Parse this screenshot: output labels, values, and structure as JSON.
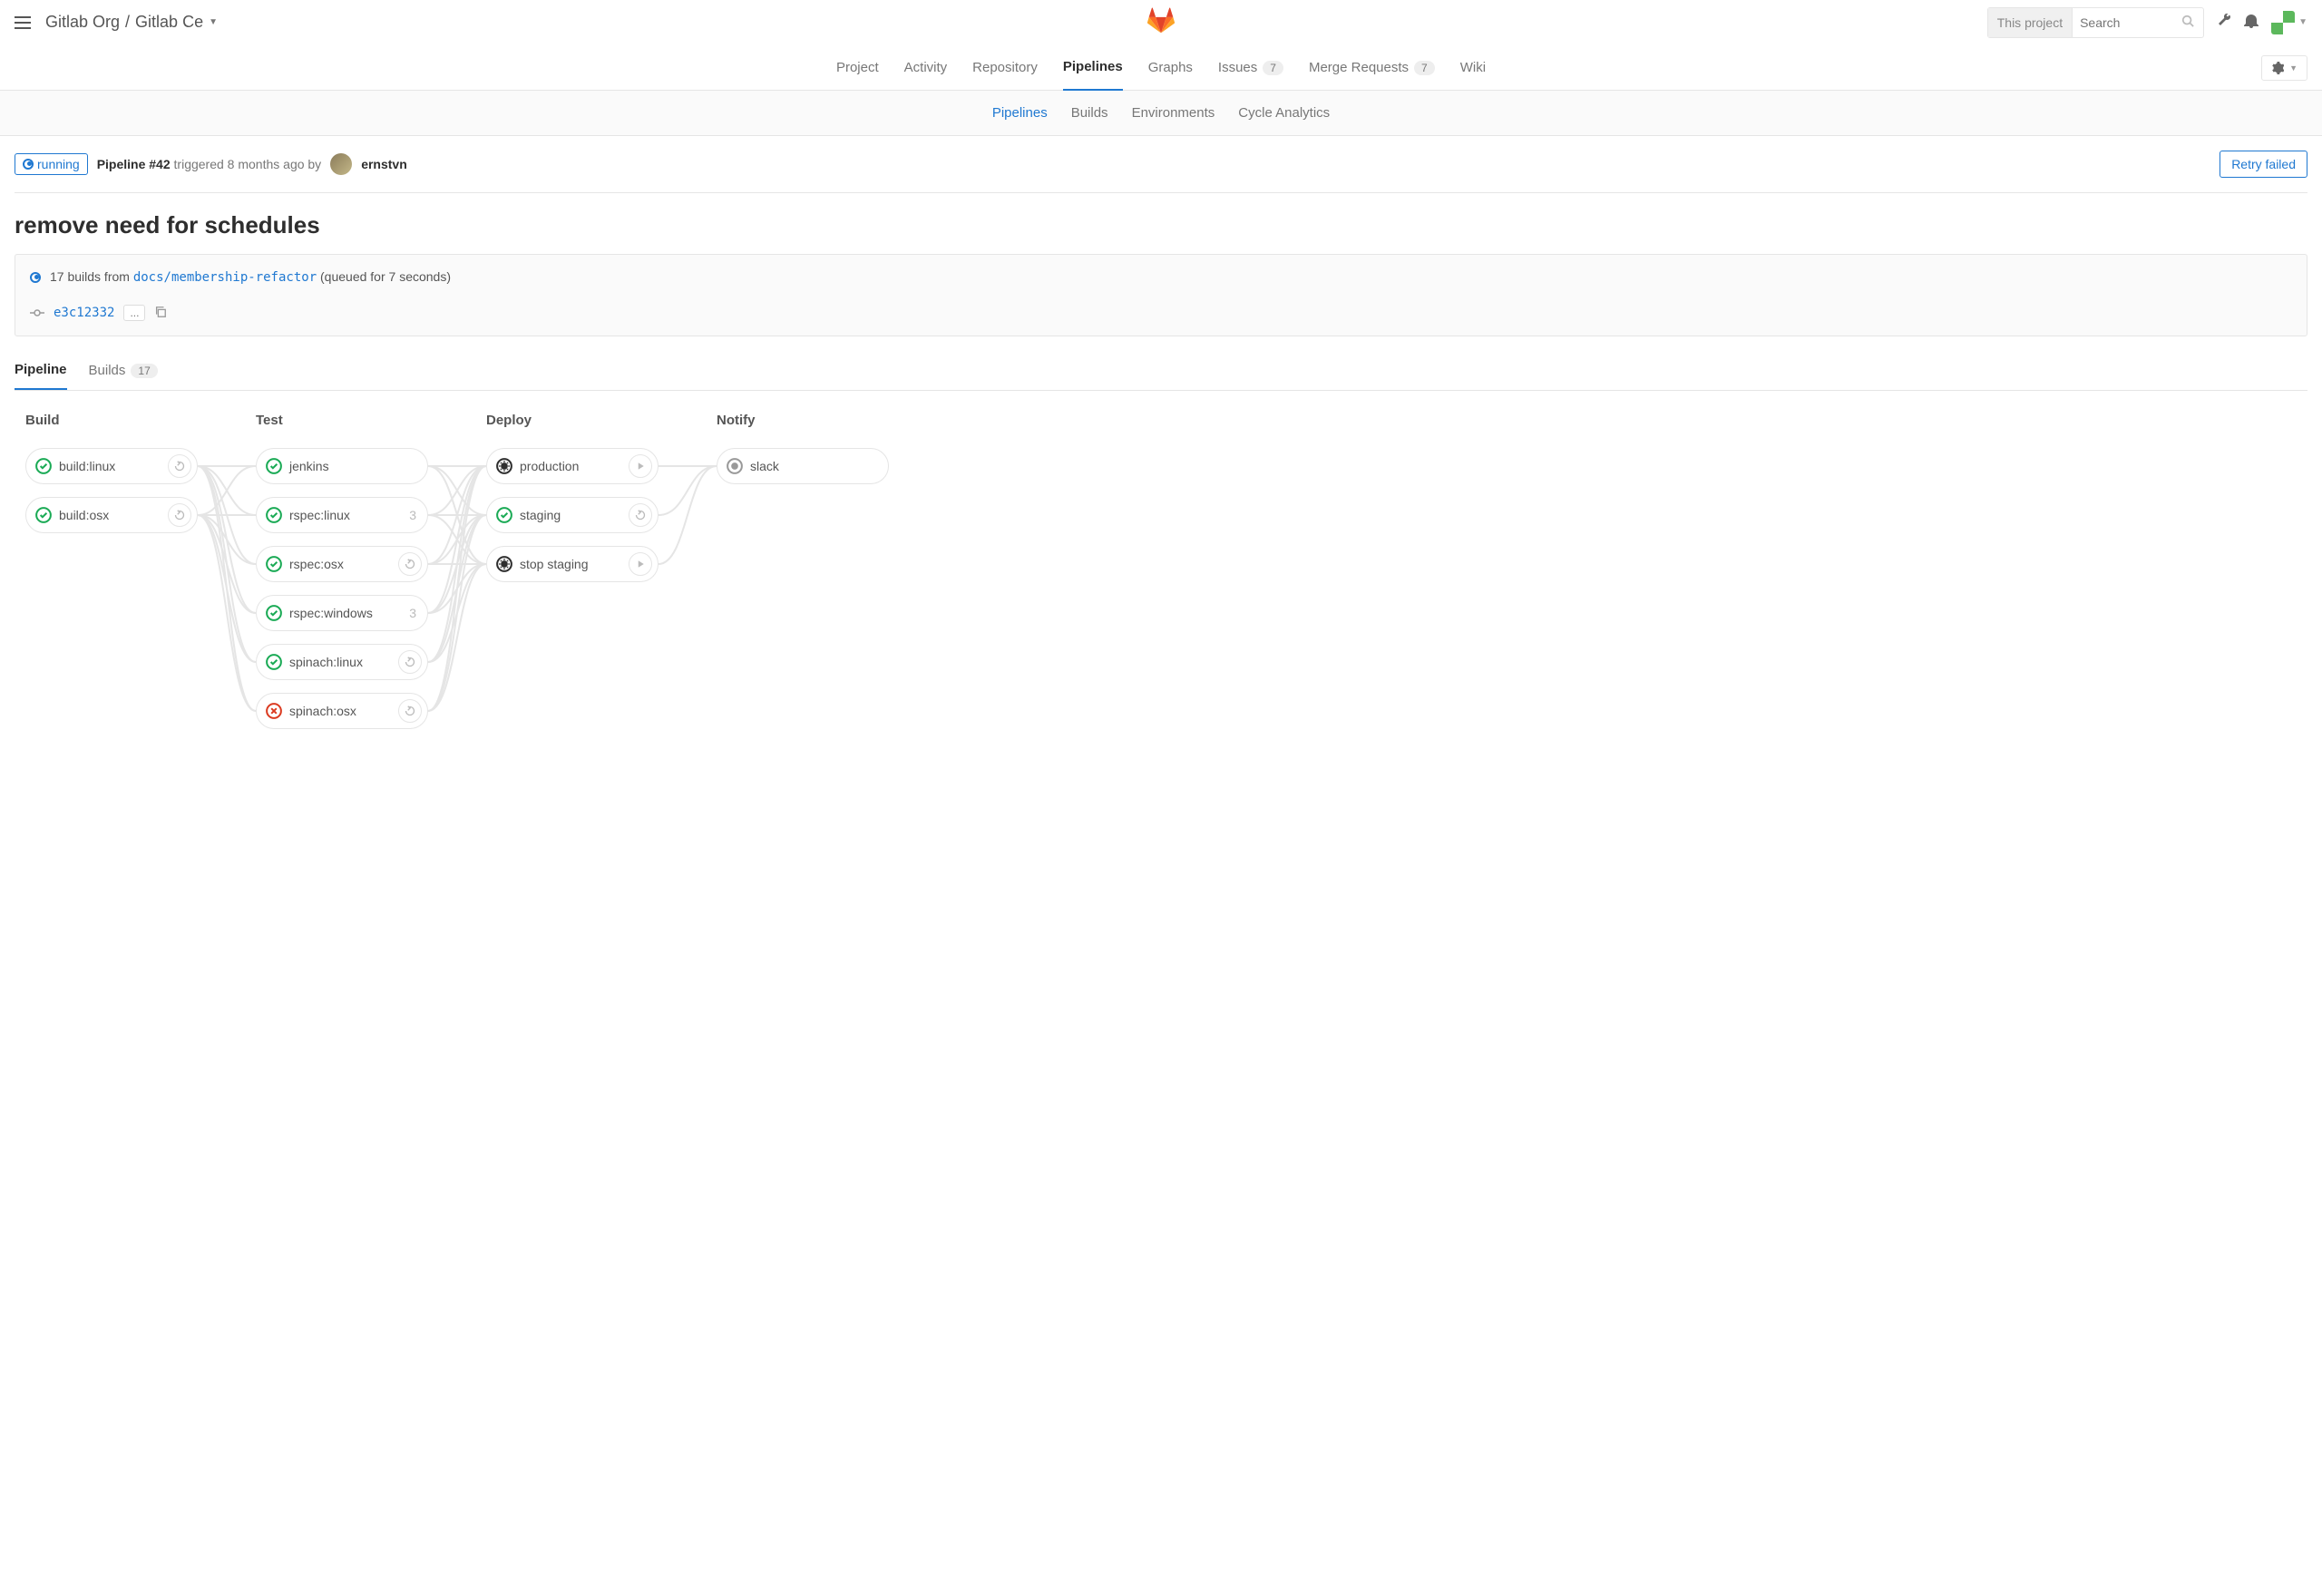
{
  "breadcrumb": {
    "org": "Gitlab Org",
    "project": "Gitlab Ce"
  },
  "search": {
    "scope": "This project",
    "placeholder": "Search"
  },
  "nav": {
    "items": [
      {
        "label": "Project"
      },
      {
        "label": "Activity"
      },
      {
        "label": "Repository"
      },
      {
        "label": "Pipelines",
        "active": true
      },
      {
        "label": "Graphs"
      },
      {
        "label": "Issues",
        "count": "7"
      },
      {
        "label": "Merge Requests",
        "count": "7"
      },
      {
        "label": "Wiki"
      }
    ]
  },
  "subnav": {
    "items": [
      {
        "label": "Pipelines",
        "active": true
      },
      {
        "label": "Builds"
      },
      {
        "label": "Environments"
      },
      {
        "label": "Cycle Analytics"
      }
    ]
  },
  "pipeline": {
    "status": "running",
    "id_label": "Pipeline #42",
    "triggered": "triggered 8 months ago by",
    "author": "ernstvn",
    "retry_label": "Retry failed",
    "title": "remove need for schedules"
  },
  "info": {
    "builds_prefix": "17 builds from",
    "branch": "docs/membership-refactor",
    "queued": "(queued for 7 seconds)",
    "sha": "e3c12332",
    "ellipsis": "..."
  },
  "detail_tabs": {
    "pipeline": "Pipeline",
    "builds": "Builds",
    "builds_count": "17"
  },
  "stages": [
    {
      "name": "Build",
      "jobs": [
        {
          "name": "build:linux",
          "status": "success",
          "action": "retry"
        },
        {
          "name": "build:osx",
          "status": "success",
          "action": "retry"
        }
      ]
    },
    {
      "name": "Test",
      "jobs": [
        {
          "name": "jenkins",
          "status": "success"
        },
        {
          "name": "rspec:linux",
          "status": "success",
          "count": "3"
        },
        {
          "name": "rspec:osx",
          "status": "success",
          "action": "retry"
        },
        {
          "name": "rspec:windows",
          "status": "success",
          "count": "3"
        },
        {
          "name": "spinach:linux",
          "status": "success",
          "action": "retry"
        },
        {
          "name": "spinach:osx",
          "status": "failed",
          "action": "retry"
        }
      ]
    },
    {
      "name": "Deploy",
      "jobs": [
        {
          "name": "production",
          "status": "manual",
          "action": "play"
        },
        {
          "name": "staging",
          "status": "success",
          "action": "retry"
        },
        {
          "name": "stop staging",
          "status": "manual",
          "action": "play"
        }
      ]
    },
    {
      "name": "Notify",
      "jobs": [
        {
          "name": "slack",
          "status": "created"
        }
      ]
    }
  ]
}
